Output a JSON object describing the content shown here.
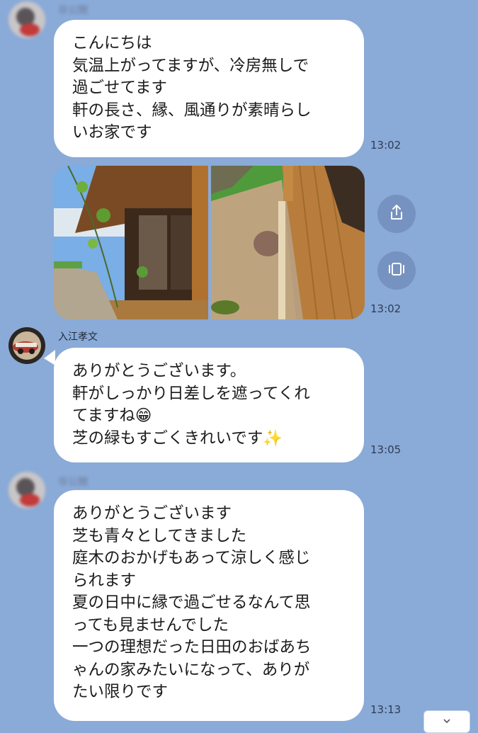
{
  "messages": [
    {
      "sender_name": "非公開",
      "lines": [
        "こんにちは",
        "気温上がってますが、冷房無しで",
        "過ごせてます",
        "軒の長さ、縁、風通りが素晴らし",
        "いお家です"
      ],
      "time": "13:02"
    },
    {
      "type": "photos",
      "photos": [
        {
          "subject": "house-veranda-garden-photo"
        },
        {
          "subject": "wooden-deck-gravel-photo"
        }
      ],
      "actions": [
        "share-icon",
        "gallery-icon"
      ],
      "time": "13:02"
    },
    {
      "sender_name": "入江孝文",
      "lines": [
        "ありがとうございます。",
        "軒がしっかり日差しを遮ってくれ",
        "てますね😁",
        "芝の緑もすごくきれいです✨"
      ],
      "time": "13:05"
    },
    {
      "sender_name": "非公開",
      "lines": [
        "ありがとうございます",
        "芝も青々としてきました",
        "庭木のおかげもあって涼しく感じ",
        "られます",
        "夏の日中に縁で過ごせるなんて思",
        "っても見ませんでした",
        "一つの理想だった日田のおばあち",
        "ゃんの家みたいになって、ありが",
        "たい限りです"
      ],
      "time": "13:13"
    }
  ],
  "colors": {
    "background": "#8aaad8",
    "bubble": "#ffffff",
    "action_button": "#7692c0"
  }
}
